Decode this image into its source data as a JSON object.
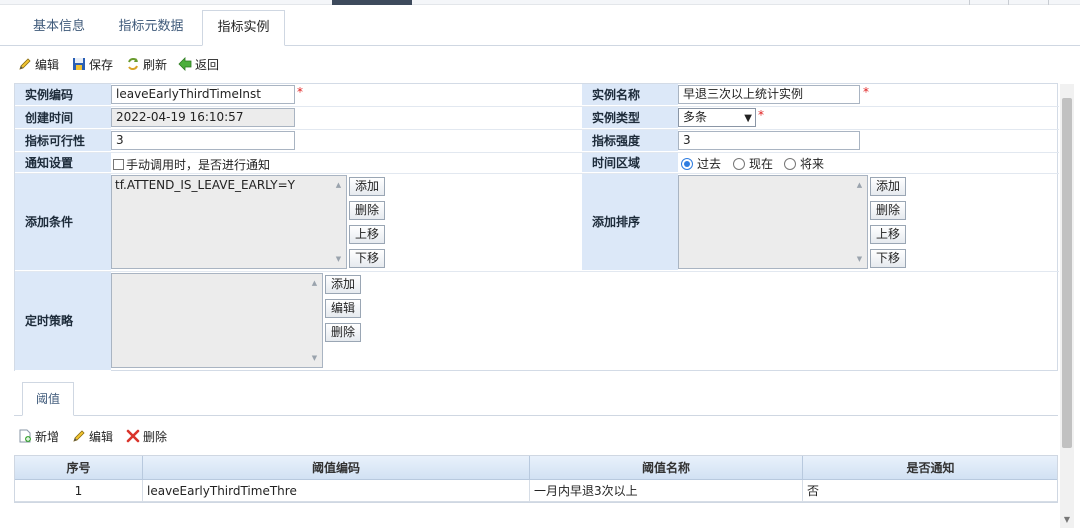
{
  "tabs": [
    "基本信息",
    "指标元数据",
    "指标实例"
  ],
  "toolbar": {
    "edit": "编辑",
    "save": "保存",
    "refresh": "刷新",
    "back": "返回"
  },
  "form": {
    "instance_code": {
      "label": "实例编码",
      "value": "leaveEarlyThirdTimeInst"
    },
    "instance_name": {
      "label": "实例名称",
      "value": "早退三次以上统计实例"
    },
    "create_time": {
      "label": "创建时间",
      "value": "2022-04-19 16:10:57"
    },
    "instance_type": {
      "label": "实例类型",
      "value": "多条"
    },
    "feasibility": {
      "label": "指标可行性",
      "value": "3"
    },
    "strength": {
      "label": "指标强度",
      "value": "3"
    },
    "notify": {
      "label": "通知设置",
      "checkbox_label": "手动调用时，是否进行通知",
      "checked": false
    },
    "time_range": {
      "label": "时间区域",
      "options": [
        "过去",
        "现在",
        "将来"
      ],
      "selected": "过去"
    },
    "conditions": {
      "label": "添加条件",
      "value": "tf.ATTEND_IS_LEAVE_EARLY=Y"
    },
    "sort": {
      "label": "添加排序",
      "value": ""
    },
    "schedule": {
      "label": "定时策略",
      "value": ""
    },
    "required_mark": "*"
  },
  "side_buttons": {
    "add": "添加",
    "delete": "删除",
    "move_up": "上移",
    "move_down": "下移",
    "edit": "编辑"
  },
  "subtab": "阈值",
  "toolbar2": {
    "new": "新增",
    "edit": "编辑",
    "delete": "删除"
  },
  "grid": {
    "headers": [
      "序号",
      "阈值编码",
      "阈值名称",
      "是否通知"
    ],
    "rows": [
      [
        "1",
        "leaveEarlyThirdTimeThre",
        "一月内早退3次以上",
        "否"
      ]
    ]
  }
}
